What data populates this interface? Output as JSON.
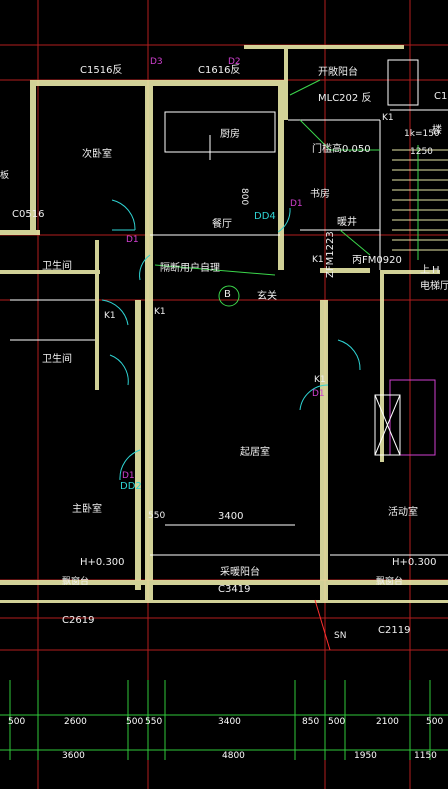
{
  "rooms": {
    "bedroom2": "次卧室",
    "kitchen": "厨房",
    "dining": "餐厅",
    "study": "书房",
    "bath1": "卫生间",
    "bath2": "卫生间",
    "living": "起居室",
    "master": "主卧室",
    "activity": "活动室",
    "entrance": "玄关",
    "balcony_open": "开敞阳台",
    "balcony_sun": "采暖阳台",
    "bay_left": "飘窗台",
    "bay_right": "飘窗台",
    "elevator_hall": "电梯厅",
    "shaft": "暖井",
    "stair_label": "楼"
  },
  "windows": {
    "c1516": "C1516反",
    "c1616": "C1616反",
    "c0516": "C0516",
    "c2619": "C2619",
    "c3419": "C3419",
    "c2119": "C2119",
    "mlc": "MLC202 反",
    "c_right": "C1"
  },
  "doors": {
    "fm0920": "丙FM0920",
    "zfm1223": "ZFM1223",
    "d1a": "D1",
    "d1b": "D1",
    "d1c": "D1",
    "d1d": "D1",
    "d3": "D3",
    "d2": "D2",
    "dd4": "DD4",
    "dd2": "DD2",
    "k1a": "K1",
    "k1b": "K1",
    "k1c": "K1",
    "k1d": "K1",
    "k1e": "K1",
    "sn": "SN"
  },
  "notes": {
    "partition": "隔断用户自理",
    "sill": "门槛高0.050",
    "h_left": "H+0.300",
    "h_right": "H+0.300",
    "unit_tag": "B",
    "d800": "800",
    "w3400": "3400",
    "w550": "550",
    "stair_dim1": "1k=150",
    "stair_dim2": "1250",
    "elev_h": "H",
    "elev_up": "上",
    "side_ban": "板"
  },
  "dims_row1": [
    "500",
    "2600",
    "500",
    "550",
    "3400",
    "850",
    "500",
    "2100",
    "500"
  ],
  "dims_row2": [
    "3600",
    "4800",
    "1950",
    "1150"
  ],
  "colors": {
    "wall": "#e8e8a8",
    "axis": "#cc2222",
    "dimline": "#2fc93a",
    "cyan": "#2fd3d3",
    "magenta": "#d040d0",
    "yellow": "#f5e03a"
  }
}
